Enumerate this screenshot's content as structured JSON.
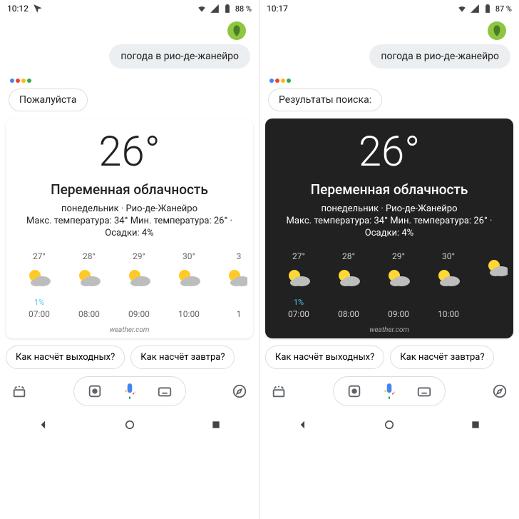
{
  "left": {
    "status": {
      "time": "10:12",
      "battery": "88 %"
    },
    "user_query": "погода в рио-де-жанейро",
    "response_label": "Пожалуйста",
    "weather": {
      "temp": "26°",
      "condition": "Переменная облачность",
      "sub1": "понедельник · Рио-де-Жанейро",
      "sub2": "Макс. температура: 34° Мин. температура: 26° ·",
      "sub3": "Осадки: 4%",
      "hours": [
        {
          "temp": "27°",
          "precip": "1%",
          "time": "07:00"
        },
        {
          "temp": "28°",
          "precip": "",
          "time": "08:00"
        },
        {
          "temp": "29°",
          "precip": "",
          "time": "09:00"
        },
        {
          "temp": "30°",
          "precip": "",
          "time": "10:00"
        },
        {
          "temp": "3",
          "precip": "",
          "time": "1"
        }
      ],
      "attribution": "weather.com"
    },
    "suggestions": [
      "Как насчёт выходных?",
      "Как насчёт завтра?"
    ]
  },
  "right": {
    "status": {
      "time": "10:17",
      "battery": "87 %"
    },
    "user_query": "погода в рио-де-жанейро",
    "response_label": "Результаты поиска:",
    "weather": {
      "temp": "26°",
      "condition": "Переменная облачность",
      "sub1": "понедельник · Рио-де-Жанейро",
      "sub2": "Макс. температура: 34° Мин. температура: 26° ·",
      "sub3": "Осадки: 4%",
      "hours": [
        {
          "temp": "27°",
          "precip": "1%",
          "time": "07:00"
        },
        {
          "temp": "28°",
          "precip": "",
          "time": "08:00"
        },
        {
          "temp": "29°",
          "precip": "",
          "time": "09:00"
        },
        {
          "temp": "30°",
          "precip": "",
          "time": "10:00"
        },
        {
          "temp": "",
          "precip": "",
          "time": ""
        }
      ],
      "attribution": "weather.com"
    },
    "suggestions": [
      "Как насчёт выходных?",
      "Как насчёт завтра?"
    ]
  }
}
